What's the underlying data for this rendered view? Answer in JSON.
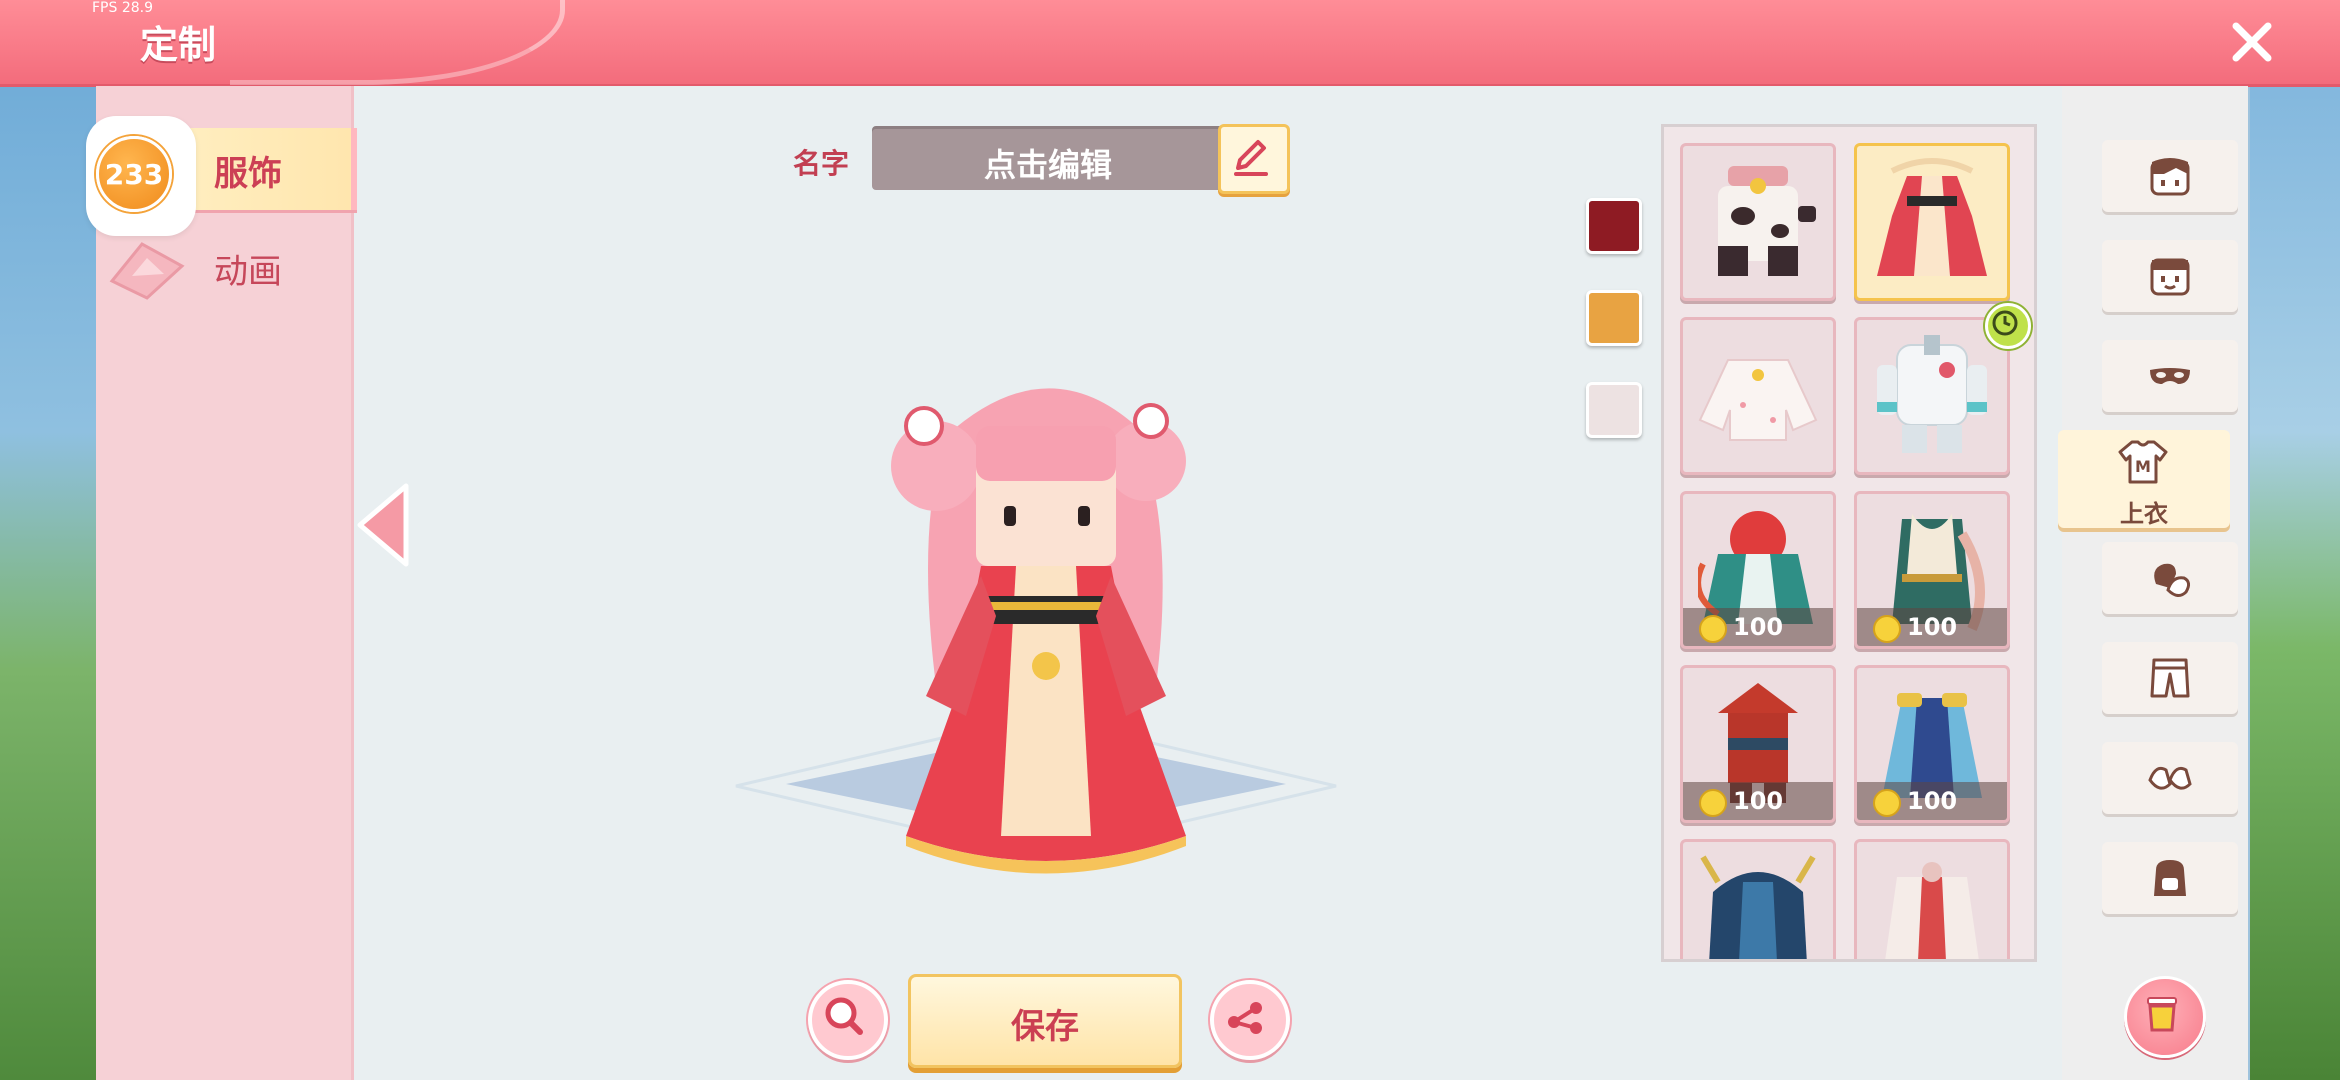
{
  "header": {
    "fps": "FPS 28.9",
    "title": "定制"
  },
  "left_tabs": [
    {
      "label": "服饰",
      "active": true
    },
    {
      "label": "动画",
      "active": false
    }
  ],
  "badge": {
    "value": "233"
  },
  "name_row": {
    "label": "名字",
    "value": "点击编辑"
  },
  "colors": [
    "#8e1b23",
    "#e8a342",
    "#ede2e2"
  ],
  "items": [
    {
      "name": "cow-costume",
      "price": null,
      "selected": false
    },
    {
      "name": "red-hanfu-dress",
      "price": null,
      "selected": true
    },
    {
      "name": "white-blouse",
      "price": null,
      "selected": false
    },
    {
      "name": "white-space-suit",
      "price": null,
      "selected": false,
      "timer": true
    },
    {
      "name": "green-red-robe",
      "price": "100",
      "selected": false
    },
    {
      "name": "teal-scarf-outfit",
      "price": "100",
      "selected": false
    },
    {
      "name": "red-hat-outfit",
      "price": "100",
      "selected": false
    },
    {
      "name": "blue-armor-outfit",
      "price": "100",
      "selected": false
    },
    {
      "name": "blue-horned-outfit",
      "price": null,
      "selected": false
    },
    {
      "name": "red-white-robe",
      "price": null,
      "selected": false
    }
  ],
  "categories": [
    {
      "icon": "hair-face-icon"
    },
    {
      "icon": "face-icon"
    },
    {
      "icon": "mask-icon"
    },
    {
      "icon": "shirt-icon",
      "label": "上衣",
      "active": true
    },
    {
      "icon": "gloves-icon"
    },
    {
      "icon": "pants-icon"
    },
    {
      "icon": "shoes-icon"
    },
    {
      "icon": "backpack-icon"
    }
  ],
  "bottom": {
    "save_label": "保存"
  }
}
